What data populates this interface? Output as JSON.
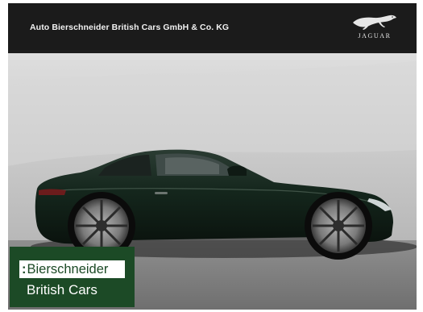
{
  "header": {
    "dealer_name": "Auto Bierschneider British Cars GmbH & Co. KG",
    "brand_logo_text": "JAGUAR"
  },
  "listing_photo": {
    "subject": "car-photo",
    "car_color": "#14261c"
  },
  "dealer_badge": {
    "line1": "Bierschneider",
    "line2": "British Cars",
    "accent_color": "#1c4a26"
  },
  "colors": {
    "header_bg": "#1b1b1b",
    "badge_green": "#1c4a26"
  }
}
